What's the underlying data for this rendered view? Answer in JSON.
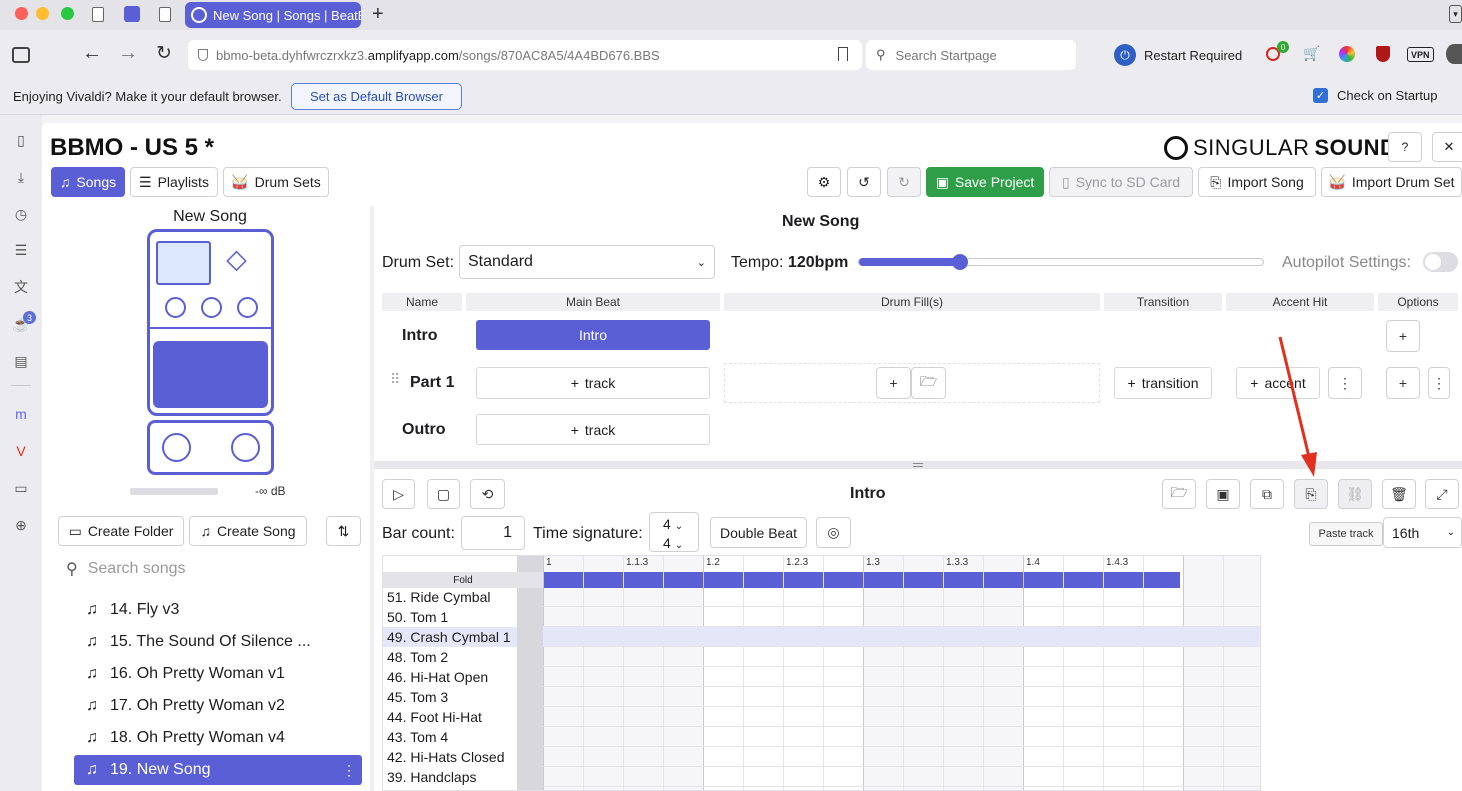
{
  "browser": {
    "tab_title": "New Song | Songs | BeatB",
    "url_host_prefix": "bbmo-beta.dyhfwrczrxkz3.",
    "url_host_bold": "amplifyapp.com",
    "url_path": "/songs/870AC8A5/4A4BD676.BBS",
    "search_placeholder": "Search Startpage",
    "restart_label": "Restart Required",
    "vpn_label": "VPN",
    "info_message": "Enjoying Vivaldi? Make it your default browser.",
    "default_button": "Set as Default Browser",
    "check_on_startup": "Check on Startup",
    "sidebar_badge": "3",
    "ext_badge": "0"
  },
  "header": {
    "title": "BBMO - US 5 *",
    "brand_light": "SINGULAR",
    "brand_bold": "SOUND",
    "help_icon": "?",
    "close_icon": "✕"
  },
  "nav": {
    "songs": "Songs",
    "playlists": "Playlists",
    "drumsets": "Drum Sets"
  },
  "toolbar": {
    "save": "Save Project",
    "sync": "Sync to SD Card",
    "import_song": "Import Song",
    "import_drum": "Import Drum Set"
  },
  "pedal": {
    "title": "New Song",
    "level": "-∞ dB"
  },
  "library": {
    "create_folder": "Create Folder",
    "create_song": "Create Song",
    "search_placeholder": "Search songs",
    "songs": [
      {
        "label": "14. Fly v3",
        "selected": false
      },
      {
        "label": "15. The Sound Of Silence ...",
        "selected": false
      },
      {
        "label": "16. Oh Pretty Woman v1",
        "selected": false
      },
      {
        "label": "17. Oh Pretty Woman v2",
        "selected": false
      },
      {
        "label": "18. Oh Pretty Woman v4",
        "selected": false
      },
      {
        "label": "19. New Song",
        "selected": true
      }
    ]
  },
  "song": {
    "title": "New Song",
    "drumset_label": "Drum Set:",
    "drumset_value": "Standard",
    "tempo_label": "Tempo:",
    "tempo_value": "120bpm",
    "tempo_fraction": 0.25,
    "autopilot_label": "Autopilot Settings:",
    "columns": [
      "Name",
      "Main Beat",
      "Drum Fill(s)",
      "Transition",
      "Accent Hit",
      "Options"
    ],
    "parts": {
      "intro": {
        "name": "Intro",
        "main": "Intro"
      },
      "part1": {
        "name": "Part 1",
        "main": "track",
        "transition": "transition",
        "accent": "accent"
      },
      "outro": {
        "name": "Outro",
        "main": "track"
      }
    }
  },
  "editor": {
    "title": "Intro",
    "bar_count_label": "Bar count:",
    "bar_count": "1",
    "time_sig_label": "Time signature:",
    "time_sig_top": "4",
    "time_sig_bottom": "4",
    "double_beat": "Double Beat",
    "tooltip": "Paste track",
    "resolution": "16th",
    "fold_label": "Fold",
    "ruler": [
      "1",
      "1.1.3",
      "1.2",
      "1.2.3",
      "1.3",
      "1.3.3",
      "1.4",
      "1.4.3"
    ],
    "instruments": [
      {
        "label": "51. Ride Cymbal",
        "selected": false
      },
      {
        "label": "50. Tom 1",
        "selected": false
      },
      {
        "label": "49. Crash Cymbal 1",
        "selected": true
      },
      {
        "label": "48. Tom 2",
        "selected": false
      },
      {
        "label": "46. Hi-Hat Open",
        "selected": false
      },
      {
        "label": "45. Tom 3",
        "selected": false
      },
      {
        "label": "44. Foot Hi-Hat",
        "selected": false
      },
      {
        "label": "43. Tom 4",
        "selected": false
      },
      {
        "label": "42. Hi-Hats Closed",
        "selected": false
      },
      {
        "label": "39. Handclaps",
        "selected": false
      }
    ]
  },
  "colors": {
    "accent": "#5b5fd6",
    "save": "#2e9e48",
    "arrow": "#e0301e"
  }
}
